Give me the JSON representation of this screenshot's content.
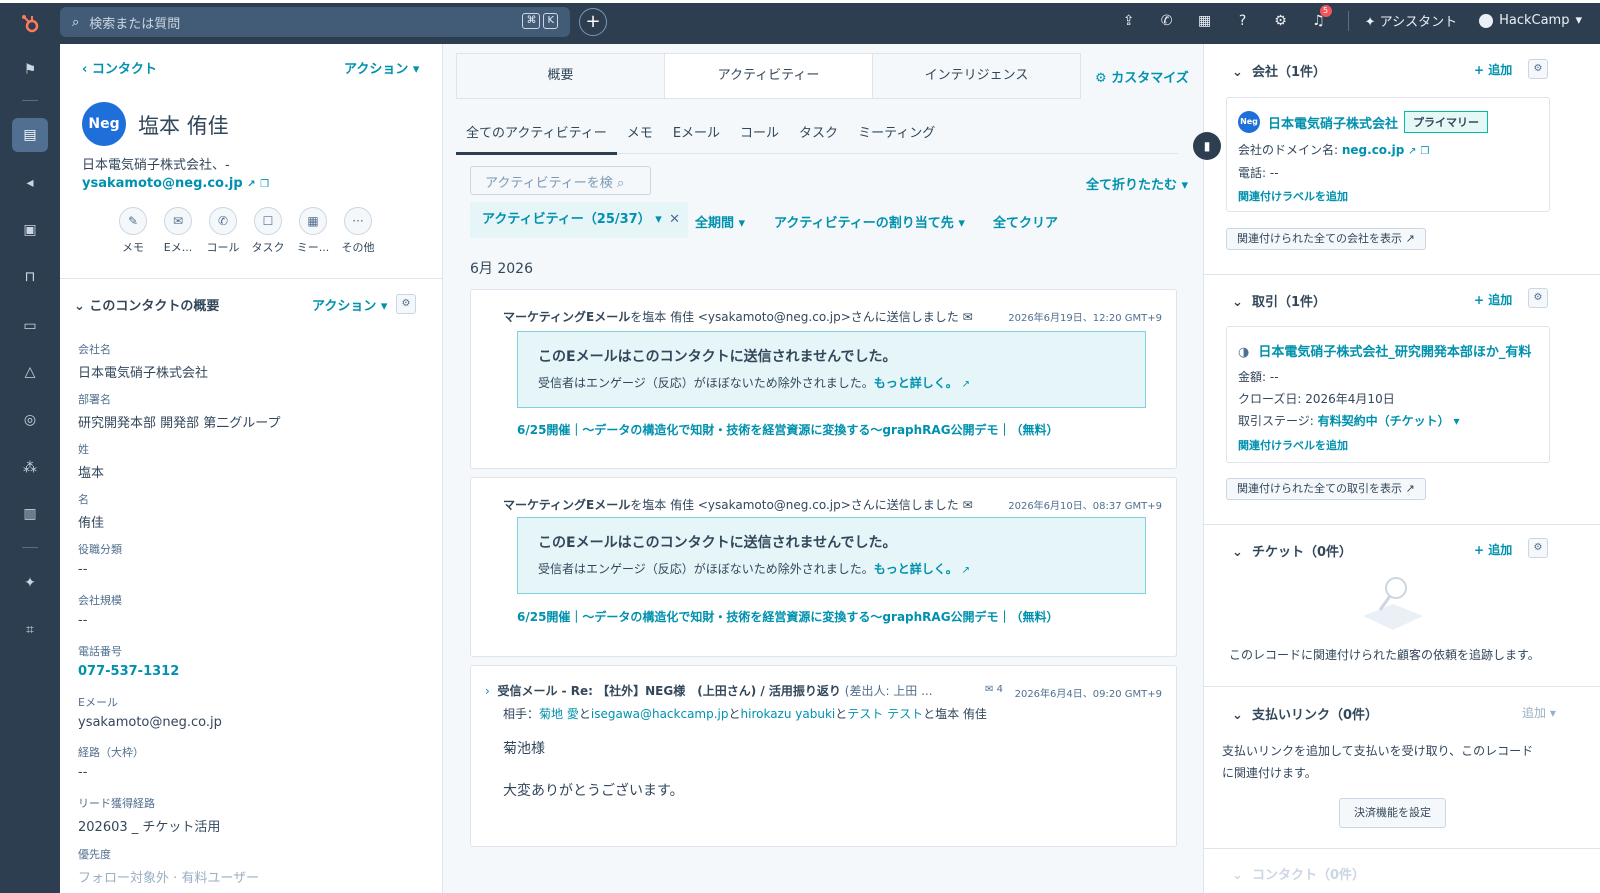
{
  "topbar": {
    "search_placeholder": "検索または質問",
    "kbd_cmd": "⌘",
    "kbd_k": "K",
    "notif_count": "5",
    "assistant": "アシスタント",
    "account": "HackCamp"
  },
  "contact": {
    "back": "コンタクト",
    "actions": "アクション",
    "avatar_text": "Neg",
    "name": "塩本 侑佳",
    "company_line": "日本電気硝子株式会社、-",
    "email": "ysakamoto@neg.co.jp",
    "quick_actions": [
      "メモ",
      "Eメ...",
      "コール",
      "タスク",
      "ミー...",
      "その他"
    ],
    "about_title": "このコンタクトの概要",
    "about_actions": "アクション",
    "properties": [
      {
        "label": "会社名",
        "value": "日本電気硝子株式会社"
      },
      {
        "label": "部署名",
        "value": "研究開発本部 開発部 第二グループ"
      },
      {
        "label": "姓",
        "value": "塩本"
      },
      {
        "label": "名",
        "value": "侑佳"
      },
      {
        "label": "役職分類",
        "value": "--"
      },
      {
        "label": "会社規模",
        "value": "--"
      },
      {
        "label": "電話番号",
        "value": "077-537-1312"
      },
      {
        "label": "Eメール",
        "value": "ysakamoto@neg.co.jp"
      },
      {
        "label": "経路（大枠）",
        "value": "--"
      },
      {
        "label": "リード獲得経路",
        "value": "202603 _ チケット活用"
      },
      {
        "label": "優先度",
        "value": "フォロー対象外 · 有料ユーザー"
      }
    ]
  },
  "middle": {
    "tabs": [
      "概要",
      "アクティビティー",
      "インテリジェンス"
    ],
    "customize": "カスタマイズ",
    "subtabs": [
      "全てのアクティビティー",
      "メモ",
      "Eメール",
      "コール",
      "タスク",
      "ミーティング"
    ],
    "activity_search": "アクティビティーを検",
    "collapse_all": "全て折りたたむ",
    "filter_chip": "アクティビティー（25/37）",
    "filter_period": "全期間",
    "filter_assign": "アクティビティーの割り当て先",
    "filter_clear": "全てクリア",
    "month": "6月 2026",
    "cards": [
      {
        "head_bold": "マーケティングEメール",
        "head_rest": "を塩本 侑佳 <ysakamoto@neg.co.jp>さんに送信しました",
        "date": "2026年6月19日、12:20 GMT+9",
        "notice_title": "このEメールはこのコンタクトに送信されませんでした。",
        "notice_desc": "受信者はエンゲージ（反応）がほぼないため除外されました。",
        "notice_link": "もっと詳しく。",
        "subject": "6/25開催｜～データの構造化で知財・技術を経営資源に変換する～graphRAG公開デモ｜（無料）"
      },
      {
        "head_bold": "マーケティングEメール",
        "head_rest": "を塩本 侑佳 <ysakamoto@neg.co.jp>さんに送信しました",
        "date": "2026年6月10日、08:37 GMT+9",
        "notice_title": "このEメールはこのコンタクトに送信されませんでした。",
        "notice_desc": "受信者はエンゲージ（反応）がほぼないため除外されました。",
        "notice_link": "もっと詳しく。",
        "subject": "6/25開催｜～データの構造化で知財・技術を経営資源に変換する～graphRAG公開デモ｜（無料）"
      }
    ],
    "inbox": {
      "head": "受信メール - Re: 【社外】NEG様　(上田さん) / 活用振り返り",
      "sender": "(差出人: 上田 ...",
      "count": "4",
      "date": "2026年6月4日、09:20 GMT+9",
      "to_label": "相手：",
      "to_1": "菊地 愛",
      "to_2": "isegawa@hackcamp.jp",
      "to_3": "hirokazu yabuki",
      "to_4": "テスト テスト",
      "to_5": "塩本 侑佳",
      "and": "と",
      "greeting": "菊池様",
      "body": "大変ありがとうございます。"
    }
  },
  "right": {
    "company_title": "会社（1件）",
    "add": "追加",
    "company_name": "日本電気硝子株式会社",
    "primary": "プライマリー",
    "domain_label": "会社のドメイン名: ",
    "domain": "neg.co.jp",
    "phone": "電話: --",
    "add_label": "関連付けラベルを追加",
    "view_companies": "関連付けられた全ての会社を表示",
    "deal_title": "取引（1件）",
    "deal_name": "日本電気硝子株式会社_研究開発本部ほか_有料",
    "deal_amount": "金額: --",
    "deal_close": "クローズ日: 2026年4月10日",
    "deal_stage_label": "取引ステージ: ",
    "deal_stage": "有料契約中（チケット）",
    "view_deals": "関連付けられた全ての取引を表示",
    "ticket_title": "チケット（0件）",
    "ticket_empty": "このレコードに関連付けられた顧客の依頼を追跡します。",
    "payment_title": "支払いリンク（0件）",
    "payment_add": "追加",
    "payment_desc_1": "支払いリンクを追加して支払いを受け取り、このレコード",
    "payment_desc_2": "に関連付けます。",
    "payment_btn": "決済機能を設定",
    "contacts_title": "コンタクト（0件）"
  }
}
